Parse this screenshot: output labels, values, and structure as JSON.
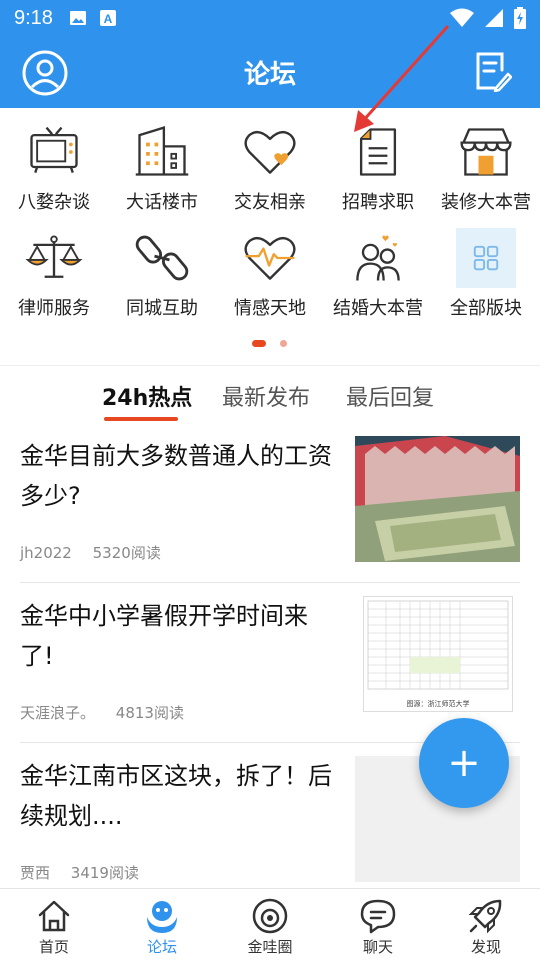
{
  "status_bar": {
    "time": "9:18"
  },
  "header": {
    "title": "论坛"
  },
  "categories": [
    {
      "label": "八婺杂谈",
      "icon": "tv-icon"
    },
    {
      "label": "大话楼市",
      "icon": "building-icon"
    },
    {
      "label": "交友相亲",
      "icon": "heart-icon"
    },
    {
      "label": "招聘求职",
      "icon": "document-icon"
    },
    {
      "label": "装修大本营",
      "icon": "house-icon"
    },
    {
      "label": "律师服务",
      "icon": "scale-icon"
    },
    {
      "label": "同城互助",
      "icon": "chain-icon"
    },
    {
      "label": "情感天地",
      "icon": "heartbeat-icon"
    },
    {
      "label": "结婚大本营",
      "icon": "couple-icon"
    },
    {
      "label": "全部版块",
      "icon": "grid-icon"
    }
  ],
  "tabs": [
    {
      "label": "24h热点",
      "active": true
    },
    {
      "label": "最新发布",
      "active": false
    },
    {
      "label": "最后回复",
      "active": false
    }
  ],
  "posts": [
    {
      "title": "金华目前大多数普通人的工资多少?",
      "author": "jh2022",
      "reads": "5320阅读"
    },
    {
      "title": "金华中小学暑假开学时间来了!",
      "author": "天涯浪子。",
      "reads": "4813阅读",
      "thumb_caption": "图源：浙江师范大学"
    },
    {
      "title": "金华江南市区这块，拆了！后续规划....",
      "author": "贾西",
      "reads": "3419阅读"
    }
  ],
  "fab": {
    "label": "+"
  },
  "bottom_nav": [
    {
      "label": "首页",
      "active": false
    },
    {
      "label": "论坛",
      "active": true
    },
    {
      "label": "金哇圈",
      "active": false
    },
    {
      "label": "聊天",
      "active": false
    },
    {
      "label": "发现",
      "active": false
    }
  ],
  "colors": {
    "primary": "#2F93EE",
    "accent": "#E8481F"
  }
}
